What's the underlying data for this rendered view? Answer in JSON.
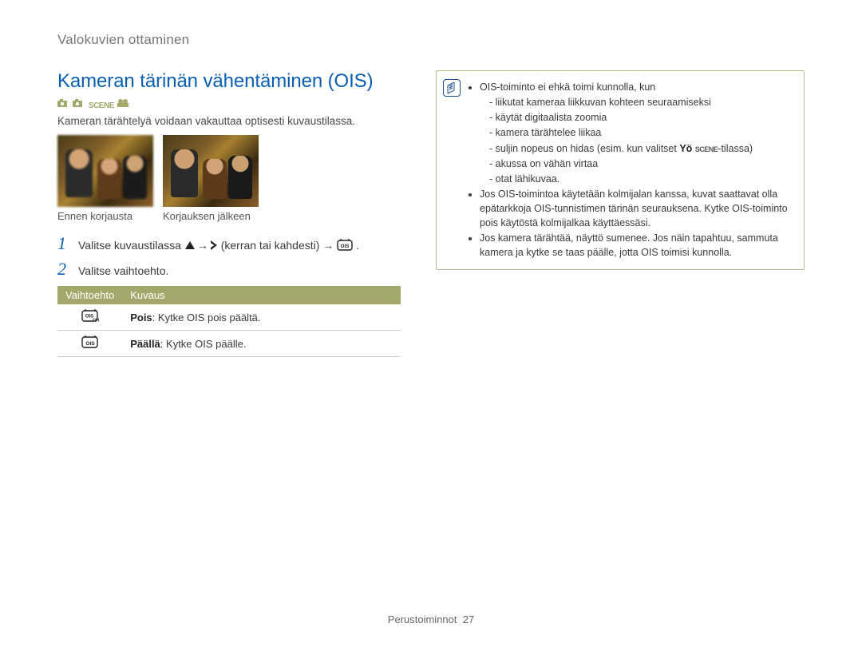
{
  "breadcrumb": "Valokuvien ottaminen",
  "title": "Kameran tärinän vähentäminen (OIS)",
  "modes": {
    "scene_label": "SCENE",
    "icons": [
      "camera-icon",
      "camera-icon",
      "scene-text",
      "movie-icon"
    ]
  },
  "intro": "Kameran tärähtelyä voidaan vakauttaa optisesti kuvaustilassa.",
  "photos": {
    "before_caption": "Ennen korjausta",
    "after_caption": "Korjauksen jälkeen"
  },
  "steps": [
    {
      "num": "1",
      "pre": "Valitse kuvaustilassa ",
      "mid1": " → ",
      "after_right": " (kerran tai kahdesti) → ",
      "end": " ."
    },
    {
      "num": "2",
      "text": "Valitse vaihtoehto."
    }
  ],
  "table": {
    "head": {
      "col1": "Vaihtoehto",
      "col2": "Kuvaus"
    },
    "rows": [
      {
        "icon": "ois-off-icon",
        "label_bold": "Pois",
        "label_rest": ": Kytke OIS pois päältä."
      },
      {
        "icon": "ois-on-icon",
        "label_bold": "Päällä",
        "label_rest": ": Kytke OIS päälle."
      }
    ]
  },
  "infobox": {
    "lead": "OIS-toiminto ei ehkä toimi kunnolla, kun",
    "sub": [
      "liikutat kameraa liikkuvan kohteen seuraamiseksi",
      "käytät digitaalista zoomia",
      "kamera tärähtelee liikaa"
    ],
    "sub_shutter_pre": "suljin nopeus on hidas (esim. kun valitset ",
    "sub_shutter_bold": "Yö ",
    "sub_shutter_scene": "SCENE",
    "sub_shutter_post": "-tilassa)",
    "sub2": [
      "akussa on vähän virtaa",
      "otat lähikuvaa."
    ],
    "tripod": "Jos OIS-toimintoa käytetään kolmijalan kanssa, kuvat saattavat olla epätarkkoja OIS-tunnistimen tärinän seurauksena. Kytke OIS-toiminto pois käytöstä kolmijalkaa käyttäessäsi.",
    "shake": "Jos kamera tärähtää, näyttö sumenee. Jos näin tapahtuu, sammuta kamera ja kytke se taas päälle, jotta OIS toimisi kunnolla."
  },
  "footer": {
    "section": "Perustoiminnot",
    "page": "27"
  }
}
